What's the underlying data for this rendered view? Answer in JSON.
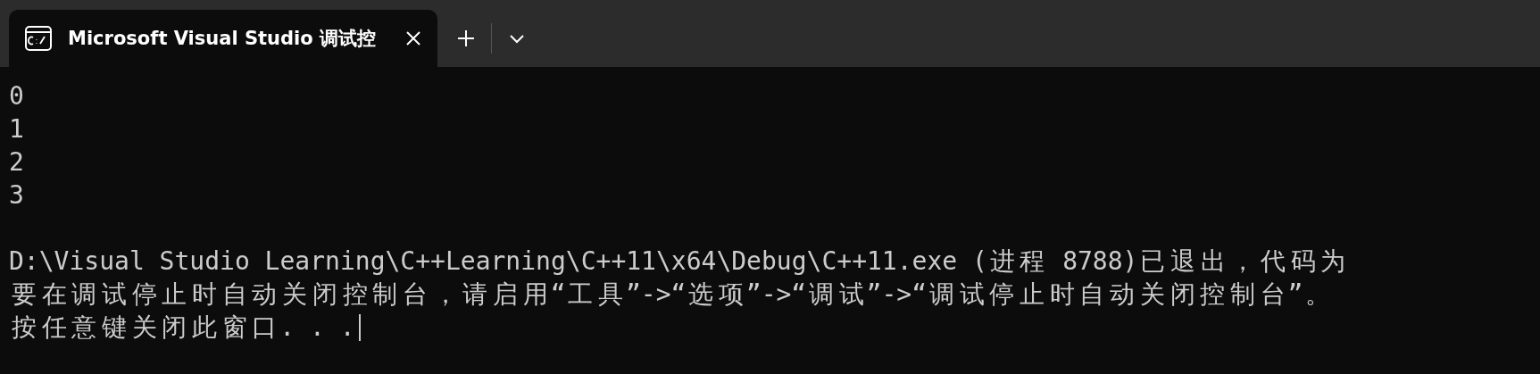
{
  "tabs": [
    {
      "title": "Microsoft Visual Studio 调试控",
      "selected": true
    }
  ],
  "console": {
    "output": [
      "0",
      "1",
      "2",
      "3"
    ],
    "messages": [
      "D:\\Visual Studio Learning\\C++Learning\\C++11\\x64\\Debug\\C++11.exe (进程 8788)已退出，代码为",
      "要在调试停止时自动关闭控制台，请启用“工具”->“选项”->“调试”->“调试停止时自动关闭控制台”。",
      "按任意键关闭此窗口. . ."
    ]
  }
}
